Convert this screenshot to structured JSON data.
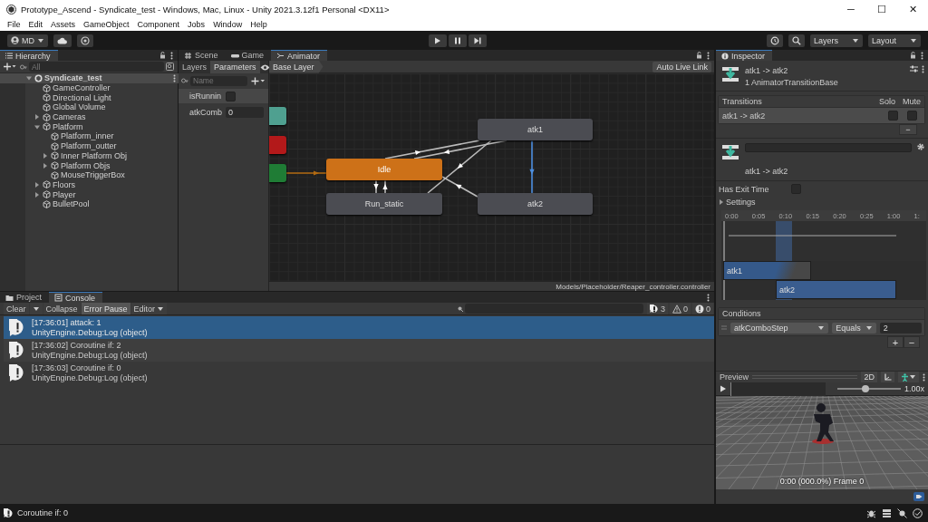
{
  "window": {
    "title": "Prototype_Ascend - Syndicate_test - Windows, Mac, Linux - Unity 2021.3.12f1 Personal <DX11>",
    "controls": [
      "─",
      "☐",
      "✕"
    ]
  },
  "menu": [
    "File",
    "Edit",
    "Assets",
    "GameObject",
    "Component",
    "Jobs",
    "Window",
    "Help"
  ],
  "toolbar": {
    "account": "MD",
    "layers": "Layers",
    "layout": "Layout"
  },
  "hierarchy": {
    "title": "Hierarchy",
    "search": {
      "placeholder": "All"
    },
    "items": [
      {
        "label": "Syndicate_test",
        "kind": "scene",
        "expanded": true,
        "children": [
          {
            "label": "GameController",
            "kind": "object"
          },
          {
            "label": "Directional Light",
            "kind": "object"
          },
          {
            "label": "Global Volume",
            "kind": "object"
          },
          {
            "label": "Cameras",
            "kind": "object",
            "expanded": false
          },
          {
            "label": "Platform",
            "kind": "object",
            "expanded": true,
            "children": [
              {
                "label": "Platform_inner",
                "kind": "object"
              },
              {
                "label": "Platform_outter",
                "kind": "object"
              },
              {
                "label": "Inner Platform Obj",
                "kind": "object",
                "expanded": false
              },
              {
                "label": "Platform Objs",
                "kind": "object",
                "expanded": false
              },
              {
                "label": "MouseTriggerBox",
                "kind": "object"
              }
            ]
          },
          {
            "label": "Floors",
            "kind": "object",
            "expanded": false
          },
          {
            "label": "Player",
            "kind": "object",
            "expanded": false
          },
          {
            "label": "BulletPool",
            "kind": "object"
          }
        ]
      }
    ]
  },
  "animator": {
    "tabs": [
      {
        "label": "Scene",
        "kind": "scene",
        "selected": false
      },
      {
        "label": "Game",
        "kind": "game",
        "selected": false
      },
      {
        "label": "Animator",
        "kind": "animator",
        "selected": true
      }
    ],
    "side_tabs": [
      {
        "label": "Layers",
        "selected": false
      },
      {
        "label": "Parameters",
        "selected": true
      }
    ],
    "param_search": {
      "placeholder": "Name"
    },
    "parameters": [
      {
        "name": "isRunnin",
        "kind": "bool",
        "checked": false
      },
      {
        "name": "atkComb",
        "kind": "int",
        "value": "0"
      }
    ],
    "breadcrumb": "Base Layer",
    "live_link": "Auto Live Link",
    "nodes": [
      {
        "kind": "any"
      },
      {
        "kind": "exit"
      },
      {
        "kind": "entry"
      },
      {
        "label": "Idle",
        "kind": "default"
      },
      {
        "label": "Run_static",
        "kind": "state"
      },
      {
        "label": "atk1",
        "kind": "state"
      },
      {
        "label": "atk2",
        "kind": "state"
      }
    ],
    "transitions": [
      {
        "selected": false
      },
      {
        "selected": false
      },
      {
        "selected": false
      },
      {
        "selected": false
      },
      {
        "selected": false
      },
      {
        "selected": false
      },
      {
        "selected": false
      },
      {
        "selected": true
      }
    ],
    "path": "Models/Placeholder/Reaper_controller.controller"
  },
  "inspector": {
    "title": "Inspector",
    "header": {
      "name": "atk1 -> atk2",
      "subtitle": "1 AnimatorTransitionBase"
    },
    "transitions": {
      "title": "Transitions",
      "columns": [
        "Solo",
        "Mute"
      ],
      "rows": [
        {
          "label": "atk1 -> atk2",
          "solo": false,
          "mute": false
        }
      ],
      "remove": "−"
    },
    "transition": {
      "label": "atk1 -> atk2"
    },
    "has_exit_time": {
      "label": "Has Exit Time",
      "checked": false
    },
    "settings": {
      "label": "Settings",
      "expanded": false
    },
    "timeline": {
      "ticks": [
        "0:00",
        "0:05",
        "0:10",
        "0:15",
        "0:20",
        "0:25",
        "1:00",
        "1:"
      ],
      "tracks": [
        "atk1",
        "atk2"
      ]
    },
    "conditions": {
      "title": "Conditions",
      "rows": [
        {
          "parameter": "atkComboStep",
          "operator": "Equals",
          "value": "2"
        }
      ],
      "buttons": [
        "+",
        "−"
      ]
    },
    "preview": {
      "title": "Preview",
      "mode": "2D",
      "speed": "1.00x",
      "level": 0.45,
      "caption": "0:00 (000.0%) Frame 0"
    }
  },
  "console": {
    "tabs": [
      {
        "label": "Project",
        "kind": "project",
        "selected": false
      },
      {
        "label": "Console",
        "kind": "console",
        "selected": true
      }
    ],
    "buttons": [
      {
        "label": "Clear",
        "kind": "button",
        "on": false
      },
      {
        "kind": "caret",
        "on": false
      },
      {
        "label": "Collapse",
        "kind": "toggle",
        "on": false
      },
      {
        "label": "Error Pause",
        "kind": "toggle",
        "on": true
      },
      {
        "label": "Editor",
        "kind": "dropdown",
        "on": false
      }
    ],
    "counts": [
      {
        "kind": "info",
        "count": "3"
      },
      {
        "kind": "warning",
        "count": "0"
      },
      {
        "kind": "error",
        "count": "0"
      }
    ],
    "entries": [
      {
        "message": "[17:36:01] attack: 1",
        "trace": "UnityEngine.Debug:Log (object)",
        "selected": true
      },
      {
        "message": "[17:36:02] Coroutine if: 2",
        "trace": "UnityEngine.Debug:Log (object)",
        "selected": false
      },
      {
        "message": "[17:36:03] Coroutine if: 0",
        "trace": "UnityEngine.Debug:Log (object)",
        "selected": false
      }
    ]
  },
  "status_bar": {
    "message": "Coroutine if: 0"
  }
}
